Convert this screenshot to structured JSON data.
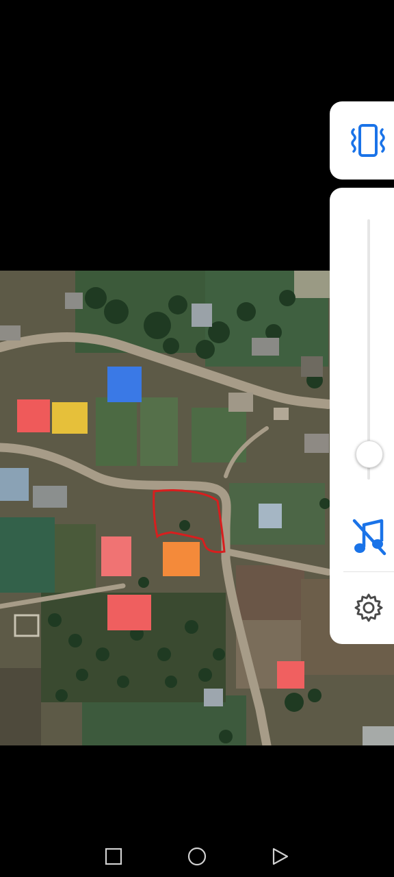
{
  "map": {
    "highlight_color": "#d81e1e",
    "road_color": "#a79c88"
  },
  "volume_panel": {
    "vibrate_icon": "vibrate-icon",
    "accent_color": "#1a73e8",
    "level": 0.1,
    "music_icon": "music-off-icon",
    "settings_icon": "gear-icon"
  },
  "navbar": {
    "back_icon": "triangle-back-icon",
    "home_icon": "circle-home-icon",
    "recents_icon": "square-recents-icon"
  }
}
